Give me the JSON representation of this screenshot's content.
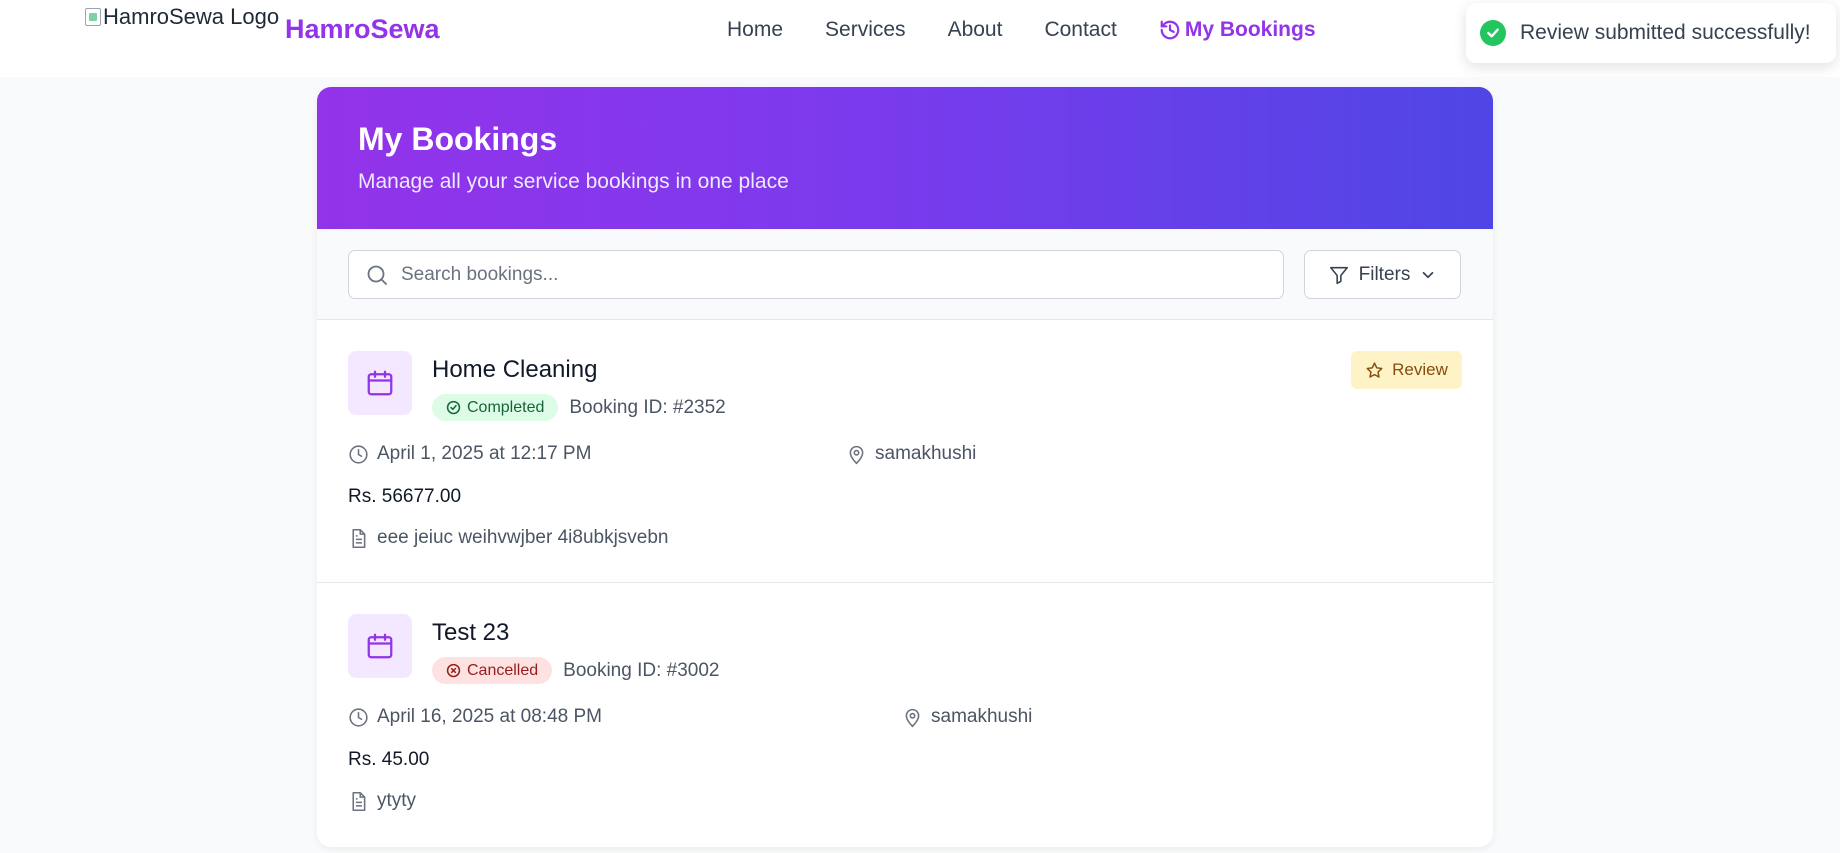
{
  "header": {
    "logo_alt": "HamroSewa Logo",
    "brand": "HamroSewa",
    "nav": [
      "Home",
      "Services",
      "About",
      "Contact"
    ],
    "active_nav": "My Bookings"
  },
  "toast": {
    "message": "Review submitted successfully!"
  },
  "page": {
    "title": "My Bookings",
    "subtitle": "Manage all your service bookings in one place"
  },
  "toolbar": {
    "search_placeholder": "Search bookings...",
    "filters_label": "Filters"
  },
  "bookings": [
    {
      "title": "Home Cleaning",
      "status": "Completed",
      "booking_id": "Booking ID: #2352",
      "datetime": "April 1, 2025 at 12:17 PM",
      "location": "samakhushi",
      "price": "Rs. 56677.00",
      "note": "eee jeiuc weihvwjber 4i8ubkjsvebn",
      "review_label": "Review"
    },
    {
      "title": "Test 23",
      "status": "Cancelled",
      "booking_id": "Booking ID: #3002",
      "datetime": "April 16, 2025 at 08:48 PM",
      "location": "samakhushi",
      "price": "Rs. 45.00",
      "note": "ytyty"
    }
  ],
  "colors": {
    "brand": "#9333ea",
    "hero_start": "#9333ea",
    "hero_end": "#4f46e5",
    "completed_bg": "#dcfce7",
    "cancelled_bg": "#fee2e2",
    "review_bg": "#fef3c7",
    "toast_check": "#22c55e"
  }
}
